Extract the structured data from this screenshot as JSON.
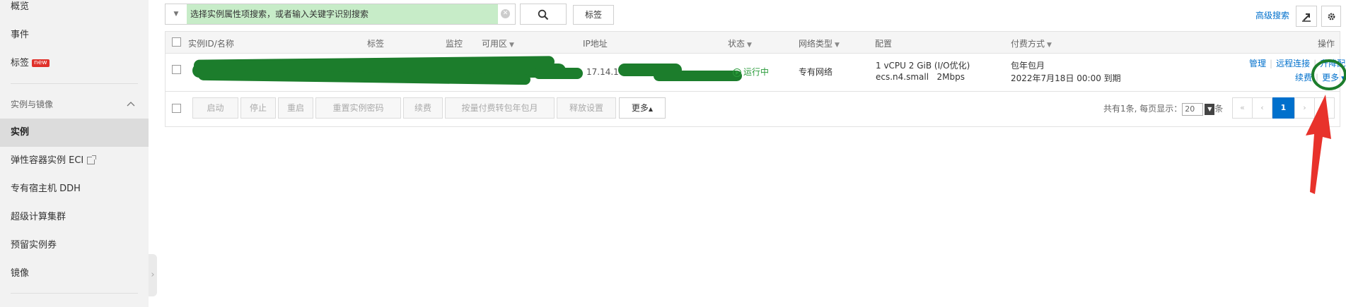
{
  "sidebar": {
    "items": [
      {
        "label": "概览"
      },
      {
        "label": "事件"
      },
      {
        "label": "标签",
        "badge": "new"
      },
      {
        "label": "实例与镜像"
      },
      {
        "label": "实例"
      },
      {
        "label": "弹性容器实例 ECI"
      },
      {
        "label": "专有宿主机 DDH"
      },
      {
        "label": "超级计算集群"
      },
      {
        "label": "预留实例券"
      },
      {
        "label": "镜像"
      }
    ],
    "active_item": "实例"
  },
  "search": {
    "placeholder": "选择实例属性项搜索，或者输入关键字识别搜索",
    "tag_button": "标签",
    "advanced_search": "高级搜索"
  },
  "table": {
    "columns": [
      {
        "label": "实例ID/名称"
      },
      {
        "label": "标签"
      },
      {
        "label": "监控"
      },
      {
        "label": "可用区"
      },
      {
        "label": "IP地址"
      },
      {
        "label": "状态"
      },
      {
        "label": "网络类型"
      },
      {
        "label": "配置"
      },
      {
        "label": "付费方式"
      },
      {
        "label": "操作"
      }
    ],
    "rows": [
      {
        "ip_fragment": "17.14.10",
        "status": "运行中",
        "network_type": "专有网络",
        "config_line1": "1 vCPU 2 GiB (I/O优化)",
        "config_line2": "ecs.n4.small   2Mbps",
        "billing_line1": "包年包月",
        "billing_line2": "2022年7月18日 00:00 到期",
        "actions": {
          "manage": "管理",
          "remote": "远程连接",
          "upgrade": "升降配",
          "renew": "续费",
          "more": "更多"
        }
      }
    ]
  },
  "batch_actions": [
    "启动",
    "停止",
    "重启",
    "重置实例密码",
    "续费",
    "按量付费转包年包月",
    "释放设置",
    "更多"
  ],
  "pagination": {
    "summary_prefix": "共有1条, 每页显示：",
    "page_size": "20",
    "summary_suffix": "条",
    "first": "«",
    "prev": "‹",
    "current": "1",
    "next": "›",
    "last": "»"
  },
  "colors": {
    "accent": "#0070cc",
    "running": "#2a9b3a",
    "annotation_red": "#e8322b",
    "annotation_green": "#1c7d2c"
  }
}
